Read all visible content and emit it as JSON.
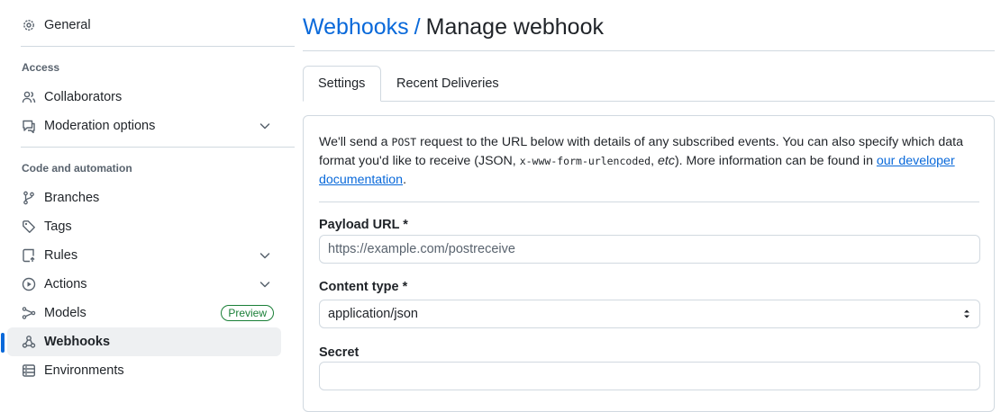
{
  "sidebar": {
    "general": "General",
    "sections": {
      "access": "Access",
      "code": "Code and automation"
    },
    "items": {
      "collaborators": "Collaborators",
      "moderation": "Moderation options",
      "branches": "Branches",
      "tags": "Tags",
      "rules": "Rules",
      "actions": "Actions",
      "models": "Models",
      "models_badge": "Preview",
      "webhooks": "Webhooks",
      "environments": "Environments"
    },
    "active_item": "webhooks"
  },
  "header": {
    "breadcrumb_link": "Webhooks",
    "separator": "/",
    "title": "Manage webhook"
  },
  "tabs": [
    {
      "label": "Settings",
      "active": true
    },
    {
      "label": "Recent Deliveries",
      "active": false
    }
  ],
  "form": {
    "intro": {
      "t1": "We'll send a ",
      "code1": "POST",
      "t2": " request to the URL below with details of any subscribed events. You can also specify which data format you'd like to receive (JSON, ",
      "code2": "x-www-form-urlencoded",
      "t3": ", ",
      "etc": "etc",
      "t4": "). More information can be found in ",
      "link": "our developer documentation",
      "t5": "."
    },
    "payload_url": {
      "label": "Payload URL *",
      "placeholder": "https://example.com/postreceive",
      "value": ""
    },
    "content_type": {
      "label": "Content type *",
      "selected": "application/json"
    },
    "secret": {
      "label": "Secret",
      "value": ""
    }
  },
  "colors": {
    "accent": "#0969da",
    "success": "#1a7f37",
    "border": "#d1d9e0",
    "active_bg": "#eef0f2"
  }
}
